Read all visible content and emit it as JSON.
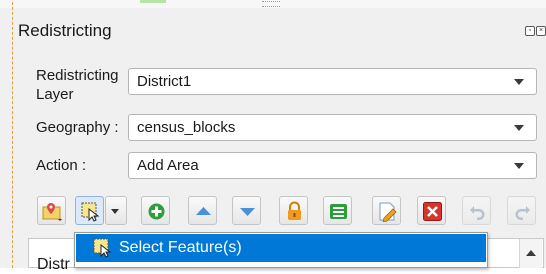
{
  "panel": {
    "title": "Redistricting"
  },
  "form": {
    "layer_label_line1": "Redistricting",
    "layer_label_line2": "Layer",
    "layer_value": "District1",
    "geography_label": "Geography :",
    "geography_value": "census_blocks",
    "action_label": "Action :",
    "action_value": "Add Area"
  },
  "toolbar": {
    "buttons": [
      "zoom-to-district-icon",
      "select-feature-tool-icon",
      "dropdown-arrow-icon",
      "add-district-icon",
      "move-up-icon",
      "move-down-icon",
      "lock-icon",
      "attribute-table-icon",
      "edit-icon",
      "delete-icon",
      "undo-icon",
      "redo-icon"
    ]
  },
  "menu": {
    "items": [
      {
        "label": "Select Feature(s)",
        "icon": "select-feature-icon"
      }
    ]
  },
  "list": {
    "partial_header": "Distr"
  },
  "colors": {
    "menu_highlight": "#0078d7",
    "add_green": "#2e9e3a",
    "arrow_blue": "#4a90d9",
    "lock_orange": "#f29a1f",
    "delete_red": "#d9342b"
  }
}
